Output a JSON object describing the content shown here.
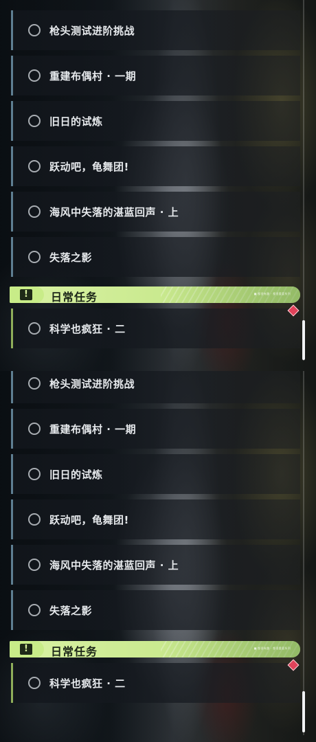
{
  "panels": [
    {
      "quests": [
        {
          "label": "枪头测试进阶挑战",
          "type": "main"
        },
        {
          "label": "重建布偶村 · 一期",
          "type": "main"
        },
        {
          "label": "旧日的试炼",
          "type": "main"
        },
        {
          "label": "跃动吧，龟舞团!",
          "type": "main"
        },
        {
          "label": "海风中失落的湛蓝回声 · 上",
          "type": "main"
        },
        {
          "label": "失落之影",
          "type": "main"
        }
      ],
      "category": {
        "title": "日常任务",
        "icon": "exclamation-icon",
        "subtitle": "■ 都很有趣 · 都很重要系列"
      },
      "daily_quests": [
        {
          "label": "科学也疯狂 · 二",
          "type": "daily"
        }
      ]
    },
    {
      "quests": [
        {
          "label": "枪头测试进阶挑战",
          "type": "main"
        },
        {
          "label": "重建布偶村 · 一期",
          "type": "main"
        },
        {
          "label": "旧日的试炼",
          "type": "main"
        },
        {
          "label": "跃动吧，龟舞团!",
          "type": "main"
        },
        {
          "label": "海风中失落的湛蓝回声 · 上",
          "type": "main"
        },
        {
          "label": "失落之影",
          "type": "main"
        }
      ],
      "category": {
        "title": "日常任务",
        "icon": "exclamation-icon",
        "subtitle": "■ 都很有趣 · 都很重要系列"
      },
      "daily_quests": [
        {
          "label": "科学也疯狂 · 二",
          "type": "daily"
        }
      ]
    }
  ],
  "colors": {
    "main_accent": "#5f7f92",
    "daily_accent": "#8fae5a",
    "category_bg": "#c9e98e",
    "alert": "#e0425a"
  }
}
